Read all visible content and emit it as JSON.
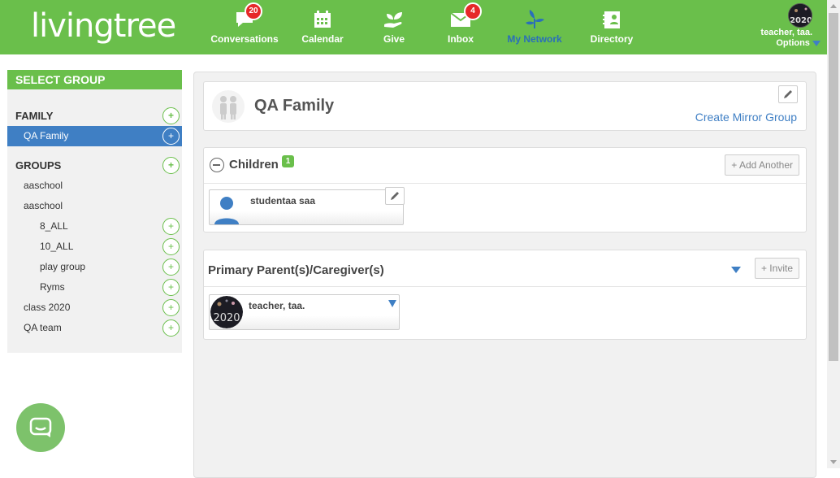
{
  "header": {
    "logo_text": "livingtree",
    "nav": [
      {
        "label": "Conversations",
        "icon": "speech-bubble-icon",
        "badge": "20"
      },
      {
        "label": "Calendar",
        "icon": "calendar-icon"
      },
      {
        "label": "Give",
        "icon": "give-hand-icon"
      },
      {
        "label": "Inbox",
        "icon": "envelope-icon",
        "badge": "4"
      },
      {
        "label": "My Network",
        "icon": "network-plant-icon",
        "active": true
      },
      {
        "label": "Directory",
        "icon": "directory-icon"
      }
    ],
    "user": {
      "name": "teacher, taa.",
      "options_label": "Options"
    }
  },
  "sidebar": {
    "title": "SELECT GROUP",
    "family_heading": "FAMILY",
    "family_items": [
      "QA Family"
    ],
    "groups_heading": "GROUPS",
    "groups": [
      {
        "label": "aaschool",
        "indent": 1
      },
      {
        "label": "aaschool",
        "indent": 1
      },
      {
        "label": "8_ALL",
        "indent": 2
      },
      {
        "label": "10_ALL",
        "indent": 2
      },
      {
        "label": "play group",
        "indent": 2
      },
      {
        "label": "Ryms",
        "indent": 2
      },
      {
        "label": "class 2020",
        "indent": 1
      },
      {
        "label": "QA team",
        "indent": 1
      }
    ],
    "plus_symbol": "+"
  },
  "main": {
    "family_name": "QA Family",
    "mirror_link": "Create Mirror Group",
    "children": {
      "title": "Children",
      "count": "1",
      "add_button": "+ Add Another",
      "members": [
        "studentaa saa"
      ]
    },
    "parents": {
      "title": "Primary Parent(s)/Caregiver(s)",
      "invite_button": "+ Invite",
      "members": [
        "teacher, taa."
      ]
    }
  },
  "colors": {
    "brand_green": "#6abf4b",
    "accent_blue": "#3f7fc4",
    "badge_red": "#e62929"
  }
}
